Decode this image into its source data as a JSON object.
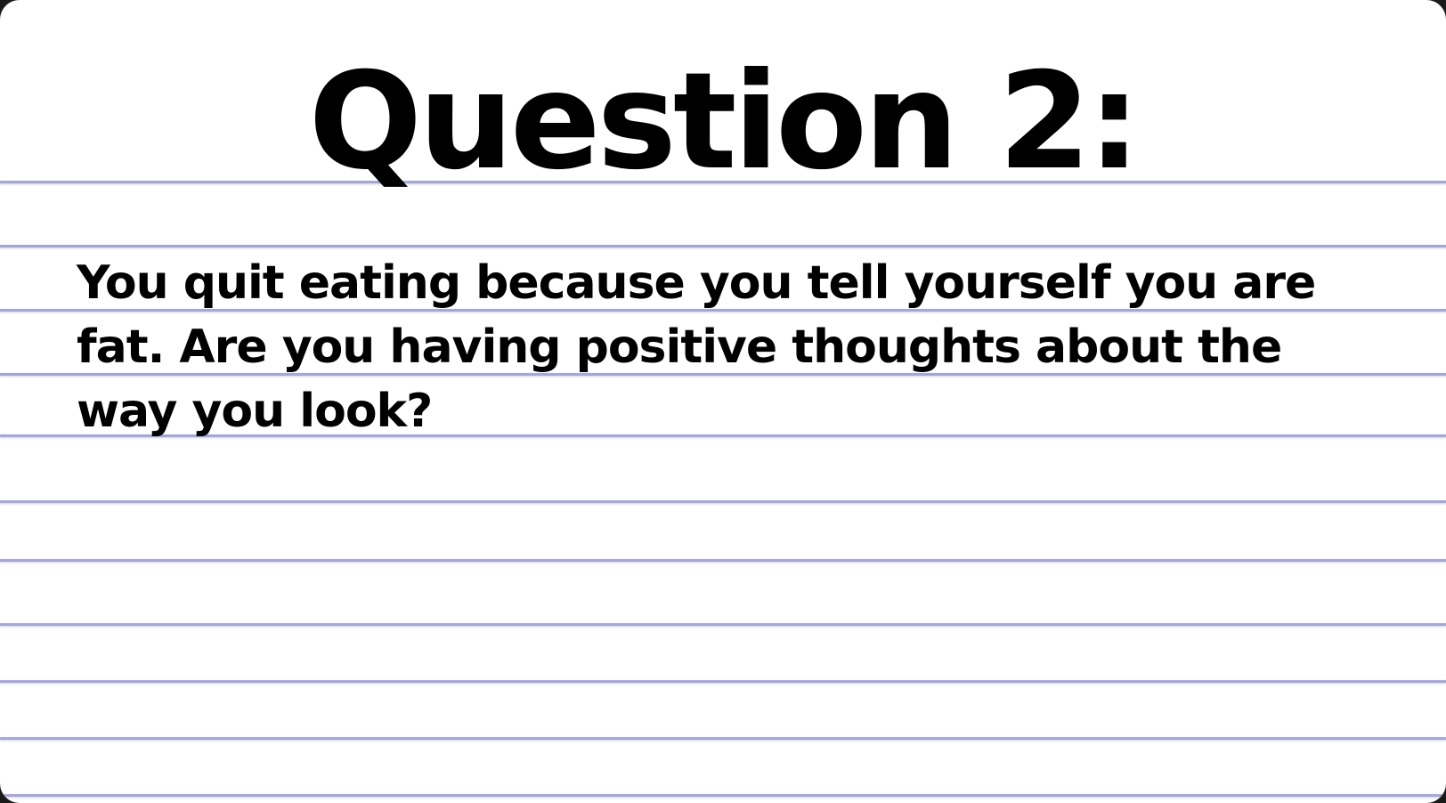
{
  "card": {
    "title": "Question 2:",
    "question": "You quit eating because you tell yourself you are fat. Are you having positive thoughts about the way you look?"
  }
}
